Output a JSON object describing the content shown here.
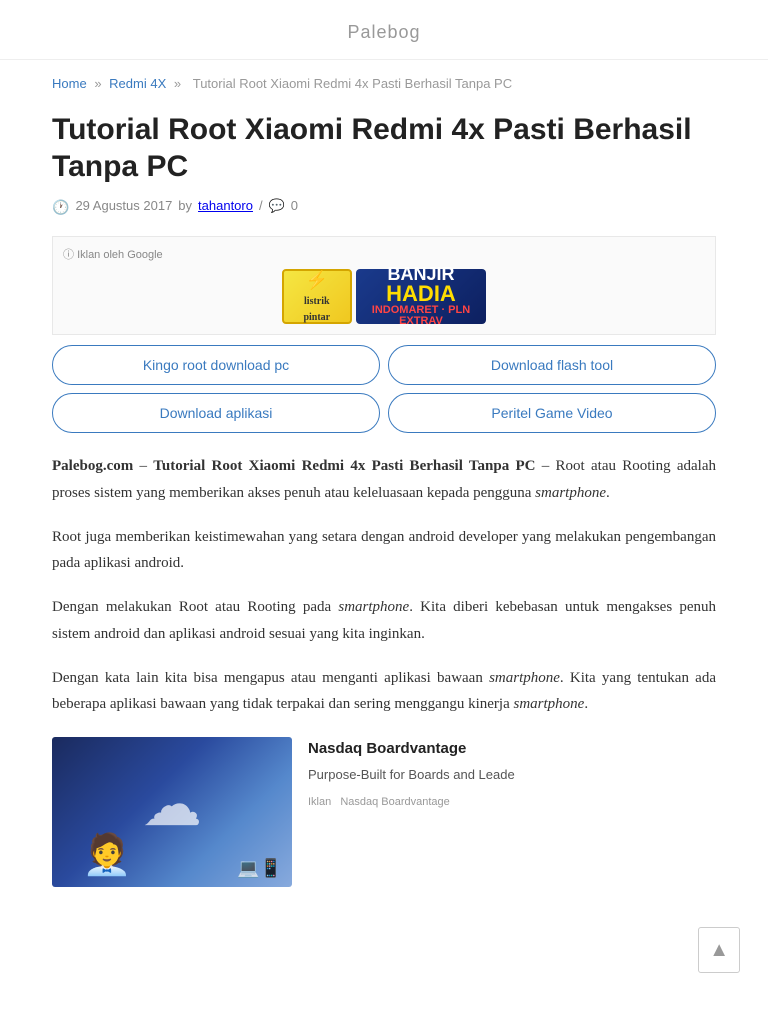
{
  "site": {
    "title": "Palebog"
  },
  "breadcrumb": {
    "home": "Home",
    "category": "Redmi 4X",
    "current": "Tutorial Root Xiaomi Redmi 4x Pasti Berhasil Tanpa PC",
    "separator": "»"
  },
  "post": {
    "title": "Tutorial Root Xiaomi Redmi 4x Pasti Berhasil Tanpa PC",
    "date": "29 Agustus 2017",
    "author": "tahantoro",
    "comment_count": "0",
    "intro_site": "Palebog.com",
    "intro_dash": "–",
    "intro_title_bold": "Tutorial Root Xiaomi Redmi 4x Pasti Berhasil Tanpa PC",
    "intro_end_dash": "–",
    "paragraph1": " Root atau Rooting adalah proses sistem yang memberikan akses penuh atau keleluasaan kepada pengguna ",
    "smartphone1": "smartphone",
    "paragraph1_end": ".",
    "paragraph2": "Root juga memberikan keistimewahan yang setara dengan android developer yang melakukan pengembangan pada aplikasi android.",
    "paragraph3_start": "Dengan melakukan Root atau Rooting pada ",
    "smartphone2": "smartphone",
    "paragraph3_end": ". Kita diberi kebebasan untuk mengakses penuh sistem  android dan aplikasi android sesuai yang kita inginkan.",
    "paragraph4_start": "Dengan kata lain kita bisa mengapus atau menganti aplikasi bawaan ",
    "smartphone3": "smartphone",
    "paragraph4_mid": ". Kita yang tentukan ada beberapa aplikasi bawaan yang tidak terpakai dan sering menggangu kinerja ",
    "smartphone4": "smartphone",
    "paragraph4_end": "."
  },
  "ad": {
    "google_label": "Iklan oleh Google",
    "info_symbol": "ⓘ",
    "listrik_line1": "listrik",
    "listrik_line2": "pintar",
    "banjir_line1": "BANJIR",
    "banjir_hadiah": "HADIA",
    "banjir_extra": "Extrav",
    "indomaret_pln": "INDOMARET · PLN"
  },
  "ad_links": {
    "link1": "Kingo root download pc",
    "link2": "Download flash tool",
    "link3": "Download aplikasi",
    "link4": "Peritel Game Video"
  },
  "promo": {
    "brand": "Nasdaq Boardvantage",
    "description": "Purpose-Built for Boards and Leade",
    "ad_label": "Iklan",
    "ad_brand": "Nasdaq Boardvantage"
  },
  "back_to_top": "▲"
}
